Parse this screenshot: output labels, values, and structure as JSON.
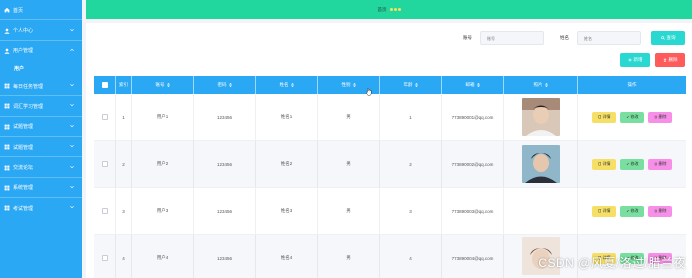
{
  "sidebar": {
    "items": [
      {
        "label": "首页",
        "icon": "home-icon",
        "expandable": false
      },
      {
        "label": "个人中心",
        "icon": "user-icon",
        "expandable": true
      },
      {
        "label": "用户管理",
        "icon": "user-icon",
        "expandable": true,
        "open": true,
        "children": [
          "用户"
        ]
      },
      {
        "label": "每日任务管理",
        "icon": "grid-icon",
        "expandable": true
      },
      {
        "label": "词汇学习管理",
        "icon": "grid-icon",
        "expandable": true
      },
      {
        "label": "试题管理",
        "icon": "grid-icon",
        "expandable": true
      },
      {
        "label": "试题管理",
        "icon": "grid-icon",
        "expandable": true
      },
      {
        "label": "交流论坛",
        "icon": "grid-icon",
        "expandable": true
      },
      {
        "label": "系统管理",
        "icon": "grid-icon",
        "expandable": true
      },
      {
        "label": "考试管理",
        "icon": "grid-icon",
        "expandable": true
      }
    ]
  },
  "header": {
    "title": "首页"
  },
  "search": {
    "account_label": "账号",
    "account_placeholder": "账号",
    "name_label": "姓名",
    "name_placeholder": "姓名",
    "query_label": "查询"
  },
  "actions": {
    "add_label": "新增",
    "delete_label": "删除"
  },
  "table": {
    "columns": [
      "索引",
      "账号",
      "密码",
      "姓名",
      "性别",
      "年龄",
      "邮箱",
      "照片",
      "操作"
    ],
    "rows": [
      {
        "index": "1",
        "account": "用户1",
        "password": "123456",
        "name": "姓名1",
        "gender": "男",
        "age": "1",
        "email": "773890001@qq.com",
        "photo": "photo-1"
      },
      {
        "index": "2",
        "account": "用户2",
        "password": "123456",
        "name": "姓名2",
        "gender": "男",
        "age": "2",
        "email": "773890002@qq.com",
        "photo": "photo-2"
      },
      {
        "index": "3",
        "account": "用户3",
        "password": "123456",
        "name": "姓名3",
        "gender": "男",
        "age": "3",
        "email": "773890003@qq.com",
        "photo": ""
      },
      {
        "index": "4",
        "account": "用户4",
        "password": "123456",
        "name": "姓名4",
        "gender": "男",
        "age": "4",
        "email": "773890004@qq.com",
        "photo": "photo-4"
      }
    ],
    "op_detail": "详情",
    "op_edit": "修改",
    "op_delete": "删除"
  },
  "watermark": "CSDN @风夏/洛过/腊兰夜",
  "colors": {
    "sidebar": "#2aa8f3",
    "topbar": "#21d79e",
    "accent": "#28d8d1",
    "danger": "#ff5b5b",
    "detail": "#f5df67",
    "edit": "#79dfa0",
    "delete": "#f78ee8"
  }
}
